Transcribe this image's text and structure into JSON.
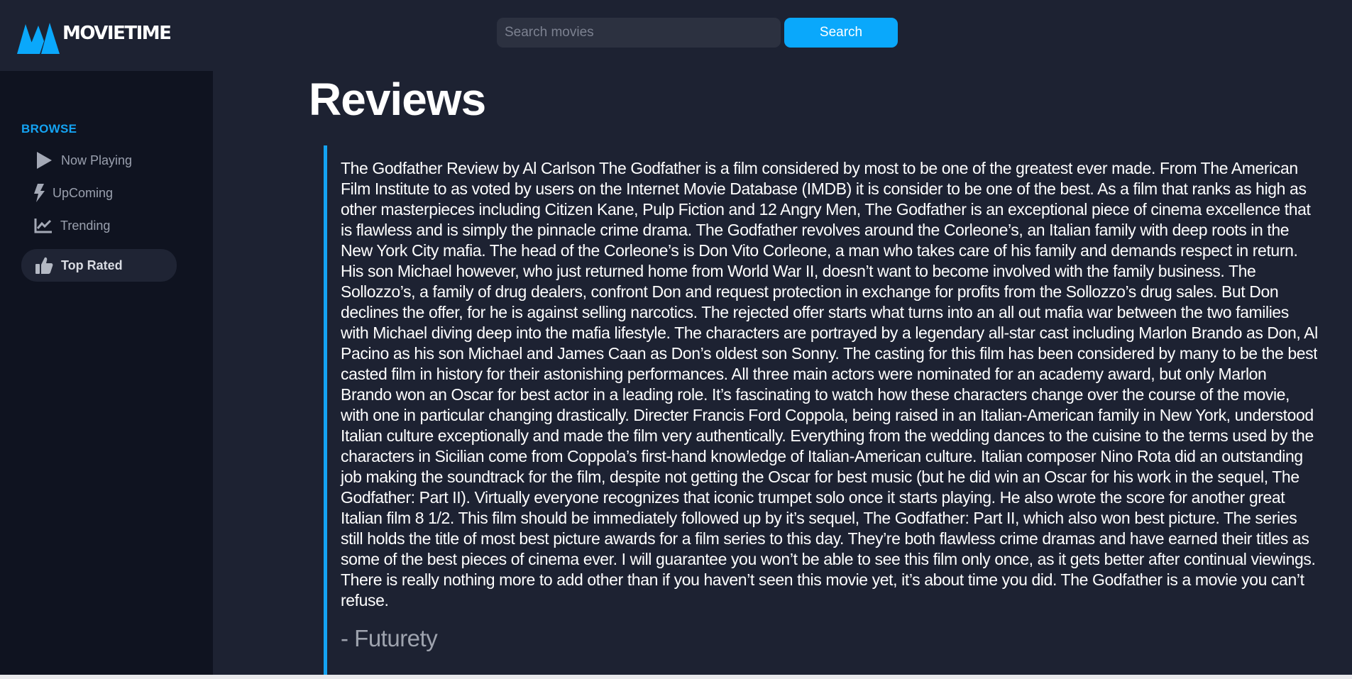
{
  "brand": {
    "name": "MOVIETIME",
    "logo_icon": "m-mountain-logo"
  },
  "search": {
    "placeholder": "Search movies",
    "value": "",
    "button_label": "Search"
  },
  "sidebar": {
    "section_label": "BROWSE",
    "items": [
      {
        "label": "Now Playing",
        "icon": "play-icon",
        "active": false
      },
      {
        "label": "UpComing",
        "icon": "bolt-icon",
        "active": false
      },
      {
        "label": "Trending",
        "icon": "trending-chart-icon",
        "active": false
      },
      {
        "label": "Top Rated",
        "icon": "thumbs-up-icon",
        "active": true
      }
    ]
  },
  "main": {
    "title": "Reviews",
    "reviews": [
      {
        "content": "The Godfather Review by Al Carlson The Godfather is a film considered by most to be one of the greatest ever made. From The American Film Institute to as voted by users on the Internet Movie Database (IMDB) it is consider to be one of the best. As a film that ranks as high as other masterpieces including Citizen Kane, Pulp Fiction and 12 Angry Men, The Godfather is an exceptional piece of cinema excellence that is flawless and is simply the pinnacle crime drama. The Godfather revolves around the Corleone’s, an Italian family with deep roots in the New York City mafia. The head of the Corleone’s is Don Vito Corleone, a man who takes care of his family and demands respect in return. His son Michael however, who just returned home from World War II, doesn’t want to become involved with the family business. The Sollozzo’s, a family of drug dealers, confront Don and request protection in exchange for profits from the Sollozzo’s drug sales. But Don declines the offer, for he is against selling narcotics. The rejected offer starts what turns into an all out mafia war between the two families with Michael diving deep into the mafia lifestyle. The characters are portrayed by a legendary all-star cast including Marlon Brando as Don, Al Pacino as his son Michael and James Caan as Don’s oldest son Sonny. The casting for this film has been considered by many to be the best casted film in history for their astonishing performances. All three main actors were nominated for an academy award, but only Marlon Brando won an Oscar for best actor in a leading role. It’s fascinating to watch how these characters change over the course of the movie, with one in particular changing drastically. Directer Francis Ford Coppola, being raised in an Italian-American family in New York, understood Italian culture exceptionally and made the film very authentically. Everything from the wedding dances to the cuisine to the terms used by the characters in Sicilian come from Coppola’s first-hand knowledge of Italian-American culture. Italian composer Nino Rota did an outstanding job making the soundtrack for the film, despite not getting the Oscar for best music (but he did win an Oscar for his work in the sequel, The Godfather: Part II). Virtually everyone recognizes that iconic trumpet solo once it starts playing. He also wrote the score for another great Italian film 8 1/2. This film should be immediately followed up by it’s sequel, The Godfather: Part II, which also won best picture. The series still holds the title of most best picture awards for a film series to this day. They’re both flawless crime dramas and have earned their titles as some of the best pieces of cinema ever. I will guarantee you won’t be able to see this film only once, as it gets better after continual viewings. There is really nothing more to add other than if you haven’t seen this movie yet, it’s about time you did. The Godfather is a movie you can’t refuse.",
        "author": "- Futurety"
      }
    ]
  },
  "colors": {
    "background": "#1d2232",
    "sidebar": "#0f1320",
    "accent": "#0aa8fb",
    "text": "#ffffff",
    "muted": "#9aa0ae"
  }
}
